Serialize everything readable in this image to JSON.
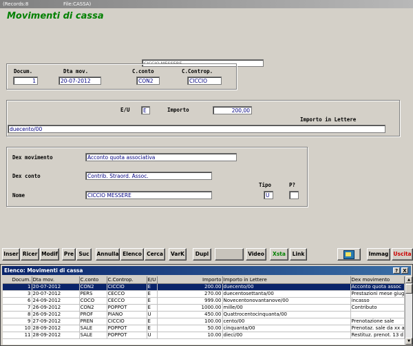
{
  "window": {
    "records_label": "(Records:8",
    "file_label": "File:CASSA)"
  },
  "form": {
    "title": "Movimenti di cassa",
    "header_name_display": "CICCIO MESSERE",
    "docum": {
      "label": "Docum.",
      "value": "1"
    },
    "dta_mov": {
      "label": "Dta mov.",
      "value": "20-07-2012"
    },
    "c_conto": {
      "label": "C.conto",
      "value": "CON2"
    },
    "c_controp": {
      "label": "C.Controp.",
      "value": "CICCIO"
    },
    "eu": {
      "label": "E/U",
      "value": "E"
    },
    "importo": {
      "label": "Importo",
      "value": "200,00"
    },
    "importo_lettere": {
      "label": "Importo in Lettere",
      "value": "duecento/00"
    },
    "dex_movimento": {
      "label": "Dex movimento",
      "value": "Acconto quota associativa"
    },
    "dex_conto": {
      "label": "Dex conto",
      "value": "Contrib. Straord. Assoc."
    },
    "nome": {
      "label": "Nome",
      "value": "CICCIO MESSERE"
    },
    "tipo": {
      "label": "Tipo",
      "value": "U"
    },
    "p": {
      "label": "P?",
      "value": ""
    }
  },
  "toolbar": {
    "inser": "Inser",
    "ricer": "Ricer",
    "modif": "Modif",
    "pre": "Pre",
    "suc": "Suc",
    "annulla": "Annulla",
    "elenco": "Elenco",
    "cerca": "Cerca",
    "vark": "VarK",
    "dupl": "Dupl",
    "video": "Video",
    "xsta": "Xsta",
    "link": "Link",
    "immag": "Immag",
    "uscita": "Uscita",
    "colors": {
      "xsta": "#008000",
      "uscita": "#cc0000"
    }
  },
  "list": {
    "title": "Elenco: Movimenti di cassa",
    "help_btn": "?",
    "close_btn": "X",
    "columns": [
      "Docum.",
      "Dta mov.",
      "C.conto",
      "C.Controp.",
      "E/U",
      "Importo",
      "Importo in Lettere",
      "Dex movimento"
    ],
    "rows": [
      [
        "1",
        "20-07-2012",
        "CON2",
        "CICCIO",
        "E",
        "200.00",
        "duecento/00",
        "Acconto quota assoc"
      ],
      [
        "3",
        "20-07-2012",
        "PERS",
        "CECCO",
        "E",
        "270.00",
        "duecentosettanta/00",
        "Prestazioni mese giug"
      ],
      [
        "6",
        "24-09-2012",
        "COCO",
        "CECCO",
        "E",
        "999.00",
        "Novecentonovantanove/00",
        "incasso"
      ],
      [
        "7",
        "26-09-2012",
        "CON2",
        "POPPOT",
        "E",
        "1000.00",
        "mille/00",
        "Contributo"
      ],
      [
        "8",
        "26-09-2012",
        "PROF",
        "PIANO",
        "U",
        "450.00",
        "Quattrocentocinquanta/00",
        ""
      ],
      [
        "9",
        "27-09-2012",
        "PREN",
        "CICCIO",
        "E",
        "100.00",
        "cento/00",
        "Prenotazione sale"
      ],
      [
        "10",
        "28-09-2012",
        "SALE",
        "POPPOT",
        "E",
        "50.00",
        "cinquanta/00",
        "Prenotaz. sale da xx a"
      ],
      [
        "11",
        "28-09-2012",
        "SALE",
        "POPPOT",
        "U",
        "10.00",
        "dieci/00",
        "Restituz. prenot. 13 d"
      ]
    ],
    "selected_row": 0
  }
}
